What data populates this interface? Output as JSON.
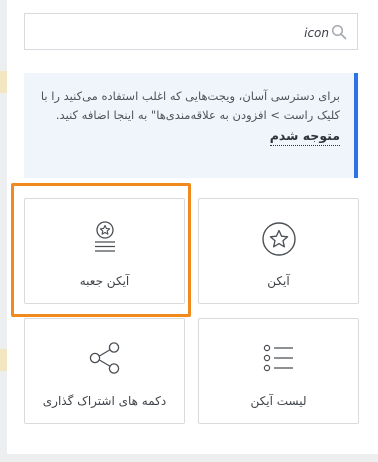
{
  "search": {
    "value": "icon",
    "icon": "search-icon"
  },
  "notice": {
    "text": "برای دسترسی آسان، ویجت‌هایی که اغلب استفاده می‌کنید را با کلیک راست > افزودن به علاقه‌مندی‌ها\" به اینجا اضافه کنید.",
    "dismiss_label": "متوجه شدم",
    "accent": "#2c73e6"
  },
  "widgets": [
    {
      "id": "icon",
      "label": "آیکن",
      "icon": "star-icon"
    },
    {
      "id": "icon-box",
      "label": "آیکن جعبه",
      "icon": "icon-box-icon",
      "highlighted": true
    },
    {
      "id": "icon-list",
      "label": "لیست آیکن",
      "icon": "list-icon"
    },
    {
      "id": "share-buttons",
      "label": "دکمه های اشتراک گذاری",
      "icon": "share-icon"
    }
  ],
  "highlight_color": "#f2891d"
}
